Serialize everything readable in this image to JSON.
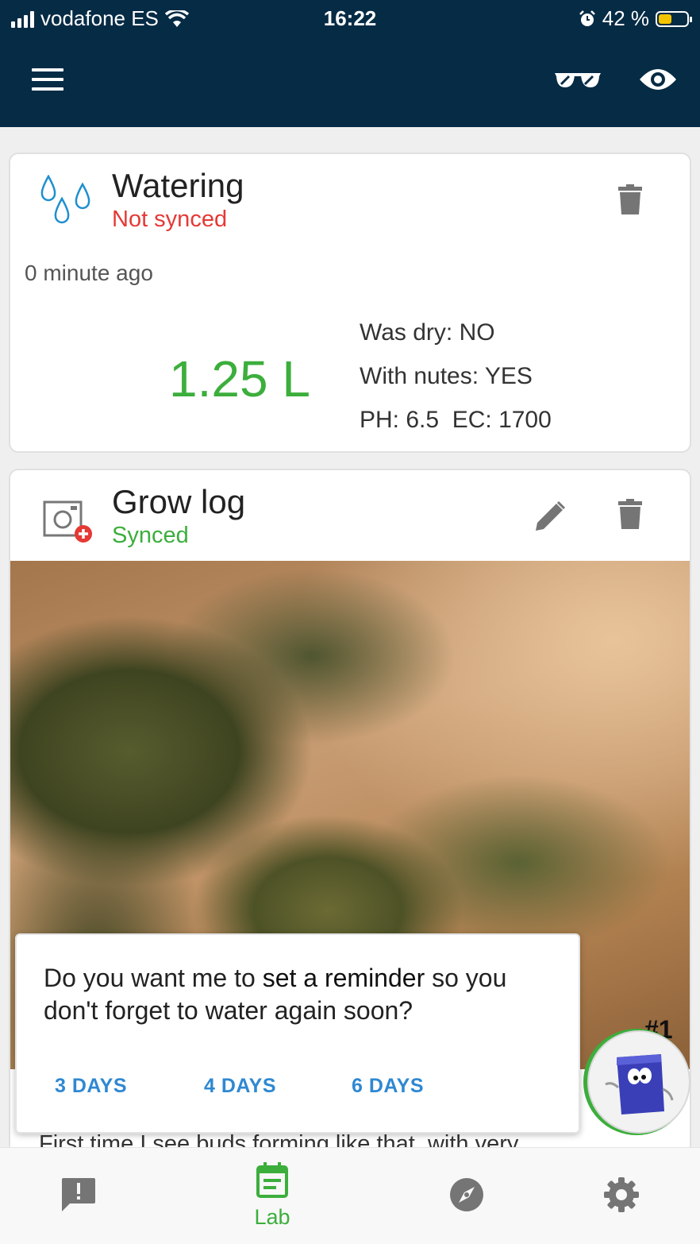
{
  "status_bar": {
    "carrier": "vodafone ES",
    "time": "16:22",
    "battery": "42 %"
  },
  "watering_card": {
    "title": "Watering",
    "sync_status": "Not synced",
    "time_ago": "0 minute ago",
    "amount": "1.25 L",
    "was_dry": "Was dry: NO",
    "with_nutes": "With nutes: YES",
    "ph_ec": "PH: 6.5  EC: 1700"
  },
  "growlog_card": {
    "title": "Grow log",
    "sync_status": "Synced",
    "caption": "First time I see buds forming like that, with very"
  },
  "dialog": {
    "question_pre": "Do you want me to ",
    "question_bold": "set a reminder",
    "question_post": " so you don't forget to water again soon?",
    "options": [
      "3 DAYS",
      "4 DAYS",
      "6 DAYS"
    ]
  },
  "mascot_badge": "#1",
  "bottom_nav": {
    "lab_label": "Lab"
  },
  "colors": {
    "appbar": "#062b45",
    "green": "#3cae3c",
    "red": "#e53935",
    "link": "#2f88d2"
  }
}
